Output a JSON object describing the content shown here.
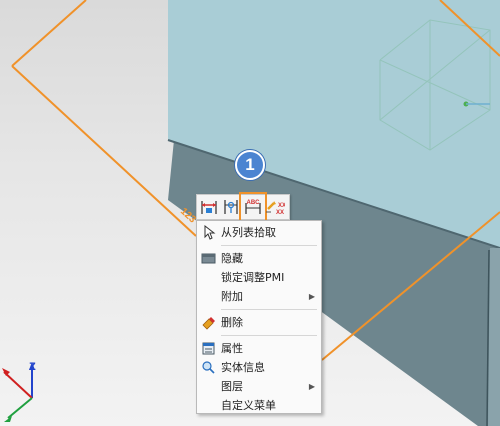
{
  "callout": {
    "number": "1",
    "color": "#4b84d1"
  },
  "dimension_text": "123",
  "toolbar": {
    "buttons": [
      {
        "name": "dimension-horizontal-icon"
      },
      {
        "name": "dimension-vertical-icon"
      },
      {
        "name": "dimension-text-abc-icon",
        "label": "ABC",
        "highlighted": true
      },
      {
        "name": "dimension-tolerance-icon",
        "label": "XX"
      }
    ]
  },
  "context_menu": {
    "items": {
      "pick_from_list": "从列表拾取",
      "hide": "隐藏",
      "lock_adjust_pmi": "锁定调整PMI",
      "attach": "附加",
      "delete": "删除",
      "properties": "属性",
      "entity_info": "实体信息",
      "layer": "图层",
      "custom_menu": "自定义菜单"
    }
  },
  "triad": {
    "z_label": "Z"
  },
  "colors": {
    "highlight_orange": "#f0922a",
    "body_blue": "#a9cdd6",
    "body_dark": "#6e868e"
  }
}
